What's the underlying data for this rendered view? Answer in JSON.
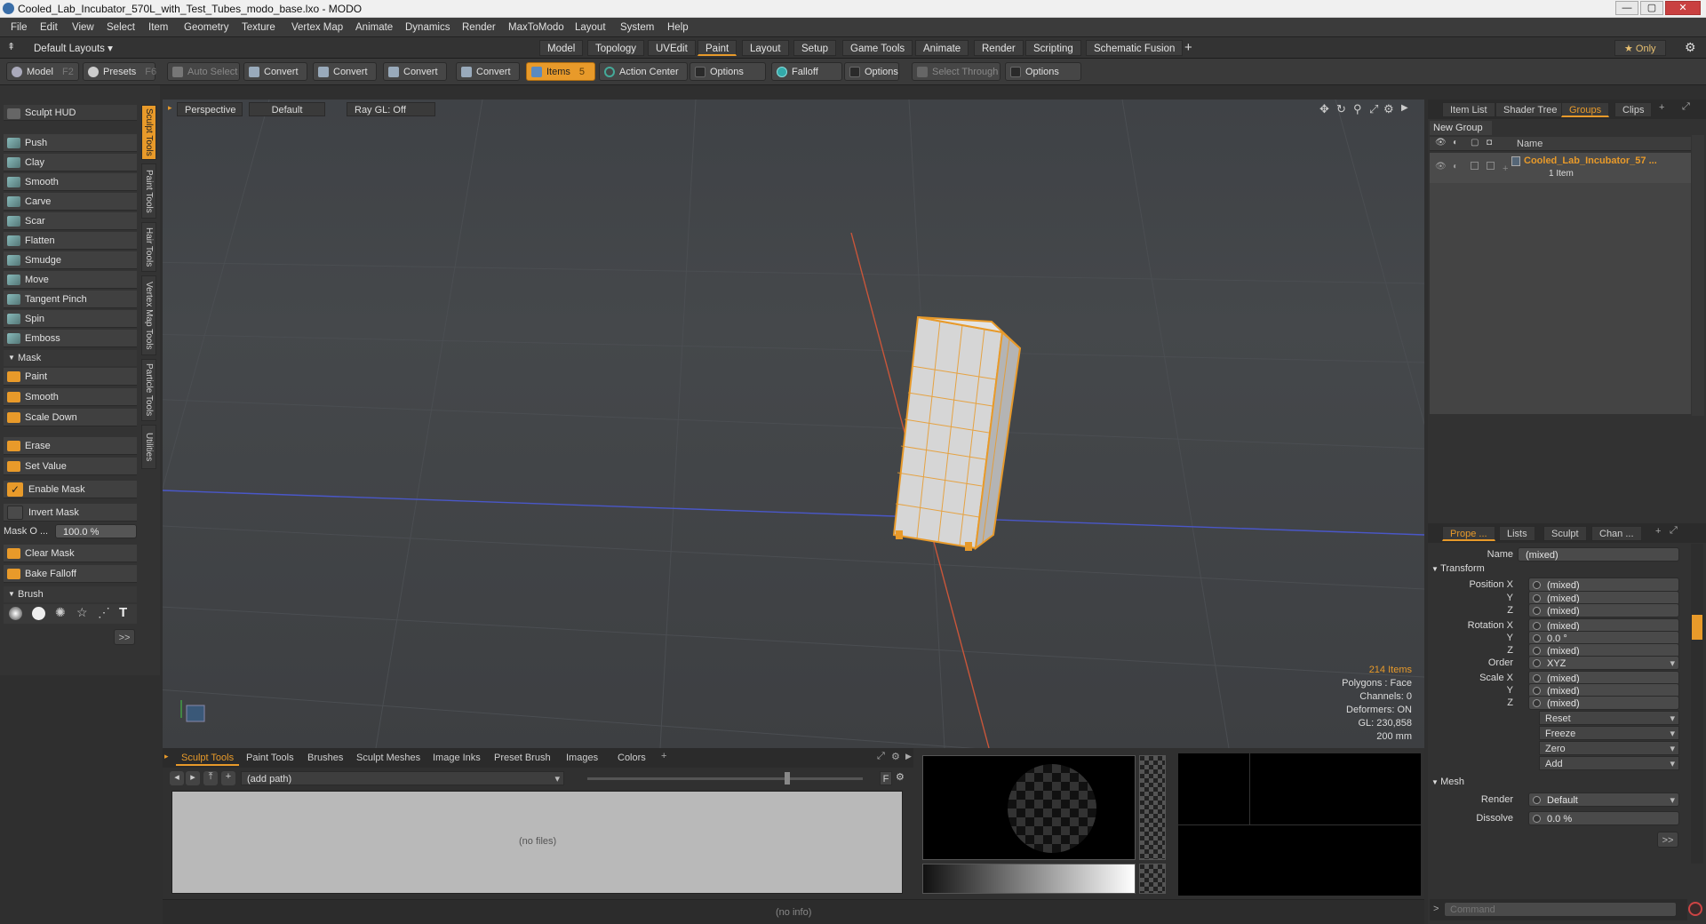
{
  "window": {
    "title": "Cooled_Lab_Incubator_570L_with_Test_Tubes_modo_base.lxo - MODO",
    "minimize": "—",
    "maximize": "▢",
    "close": "✕"
  },
  "menu": [
    "File",
    "Edit",
    "View",
    "Select",
    "Item",
    "Geometry",
    "Texture",
    "Vertex Map",
    "Animate",
    "Dynamics",
    "Render",
    "MaxToModo",
    "Layout",
    "System",
    "Help"
  ],
  "layouts": {
    "default_layouts": "Default Layouts ▾",
    "tabs": [
      "Model",
      "Topology",
      "UVEdit",
      "Paint",
      "Layout",
      "Setup",
      "Game Tools",
      "Animate",
      "Render",
      "Scripting",
      "Schematic Fusion"
    ],
    "active": "Paint",
    "add": "+",
    "only": "★  Only",
    "gear": "⚙"
  },
  "toolbar": {
    "model": "Model",
    "model_key": "F2",
    "presets": "Presets",
    "presets_key": "F6",
    "auto_select": "Auto Select",
    "convert1": "Convert",
    "convert2": "Convert",
    "convert3": "Convert",
    "convert4": "Convert",
    "items": "Items",
    "items_key": "5",
    "action_center": "Action Center",
    "options1": "Options",
    "falloff": "Falloff",
    "options2": "Options",
    "select_through": "Select Through",
    "options3": "Options"
  },
  "sculpt": {
    "hud": "Sculpt HUD",
    "tools": [
      "Push",
      "Clay",
      "Smooth",
      "Carve",
      "Scar",
      "Flatten",
      "Smudge",
      "Move",
      "Tangent Pinch",
      "Spin",
      "Emboss"
    ],
    "mask_header": "Mask",
    "mask_tools": [
      "Paint",
      "Smooth",
      "Scale Down"
    ],
    "erase": "Erase",
    "set_value": "Set Value",
    "enable_mask": "Enable Mask",
    "invert_mask": "Invert Mask",
    "mask_opacity_label": "Mask O ...",
    "mask_opacity_value": "100.0 %",
    "clear_mask": "Clear Mask",
    "bake_falloff": "Bake Falloff",
    "brush_header": "Brush",
    "more": ">>"
  },
  "side_tabs": [
    "Sculpt Tools",
    "Paint Tools",
    "Hair Tools",
    "Vertex Map Tools",
    "Particle Tools",
    "Utilities"
  ],
  "viewport": {
    "perspective": "Perspective",
    "default": "Default",
    "raygl": "Ray GL: Off",
    "stats": {
      "items": "214 Items",
      "polygons": "Polygons : Face",
      "channels": "Channels: 0",
      "deformers": "Deformers: ON",
      "gl": "GL: 230,858",
      "size": "200 mm"
    }
  },
  "right_top": {
    "tabs": [
      "Item List",
      "Shader Tree",
      "Groups",
      "Clips"
    ],
    "active": "Groups",
    "new_group": "New Group",
    "col_name": "Name",
    "group_name": "Cooled_Lab_Incubator_57 ...",
    "group_count": "1 Item"
  },
  "properties": {
    "tabs": [
      "Prope ...",
      "Lists",
      "Sculpt",
      "Chan ..."
    ],
    "name_label": "Name",
    "name_value": "(mixed)",
    "transform": "Transform",
    "position_x": "(mixed)",
    "position_y": "(mixed)",
    "position_z": "(mixed)",
    "rotation_x": "(mixed)",
    "rotation_y": "0.0 °",
    "rotation_z": "(mixed)",
    "order_label": "Order",
    "order_value": "XYZ",
    "scale_x": "(mixed)",
    "scale_y": "(mixed)",
    "scale_z": "(mixed)",
    "labels": {
      "position_x": "Position X",
      "y": "Y",
      "z": "Z",
      "rotation_x": "Rotation X",
      "scale_x": "Scale X"
    },
    "actions": [
      "Reset",
      "Freeze",
      "Zero",
      "Add"
    ],
    "mesh": "Mesh",
    "render_label": "Render",
    "render_value": "Default",
    "dissolve_label": "Dissolve",
    "dissolve_value": "0.0 %",
    "more": ">>",
    "command_placeholder": "Command"
  },
  "bottom": {
    "tabs": [
      "Sculpt Tools",
      "Paint Tools",
      "Brushes",
      "Sculpt Meshes",
      "Image Inks",
      "Preset Brush",
      "Images",
      "Colors"
    ],
    "active": "Sculpt Tools",
    "path": "(add path)",
    "no_files": "(no files)",
    "f": "F"
  },
  "status": "(no info)"
}
